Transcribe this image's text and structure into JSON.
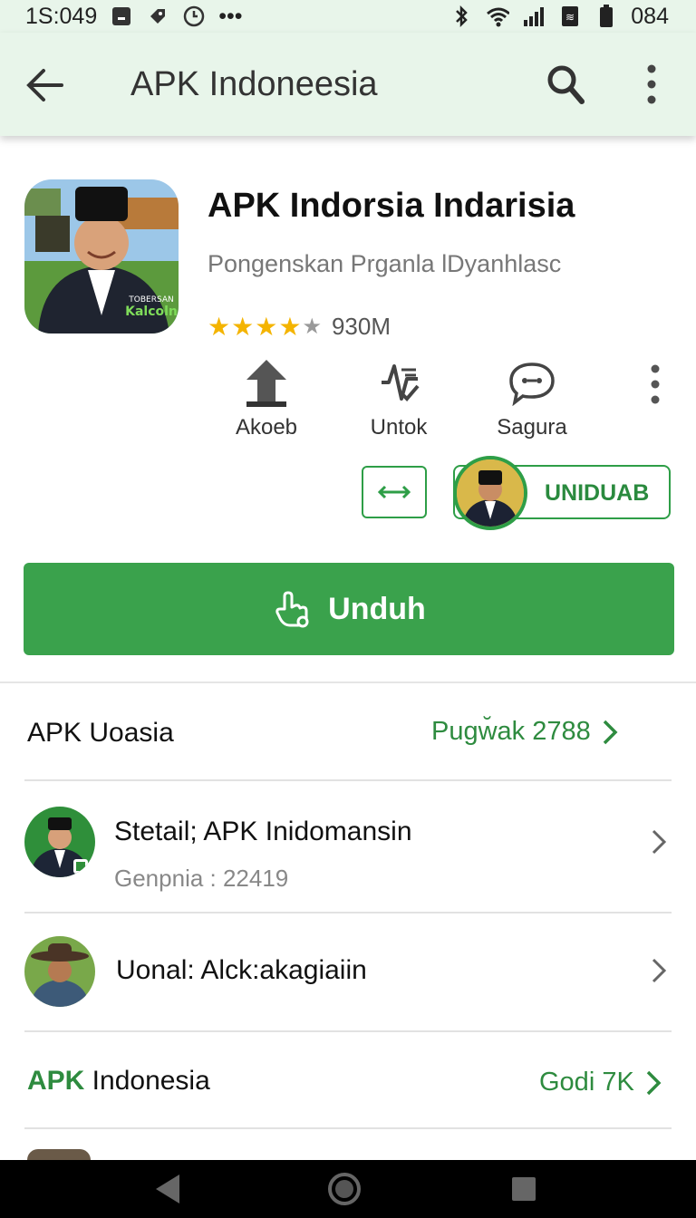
{
  "status_bar": {
    "time": "1S:049",
    "battery": "084"
  },
  "app_bar": {
    "title": "APK Indoneesia"
  },
  "app": {
    "name": "APK Indorsia Indarisia",
    "subtitle": "Pongenskan Prganla lDyanhlasc",
    "rating_stars": 4.5,
    "rating_count": "930M",
    "icon_badge_line1": "TOBERSAN",
    "icon_badge_line2": "Kalcoln"
  },
  "actions": [
    {
      "label": "Akoeb",
      "icon": "upload-arrow-icon"
    },
    {
      "label": "Untok",
      "icon": "activity-icon"
    },
    {
      "label": "Sagura",
      "icon": "chat-bubble-icon"
    }
  ],
  "secondary": {
    "unduab_label": "UNIDUAB"
  },
  "download": {
    "label": "Unduh"
  },
  "section1": {
    "title": "APK Uoasia",
    "link": "Pugw̆ak 2788"
  },
  "list": [
    {
      "title": "Stetail; APK Inidomansin",
      "sub": "Genpnia : 22419"
    },
    {
      "title": "Uonal: Alck:akagiaiin",
      "sub": ""
    }
  ],
  "section2": {
    "title_accent": "APK",
    "title_rest": " Indonesia",
    "link": "Godi 7K"
  },
  "colors": {
    "accent": "#3aa24c",
    "accent_dark": "#2e8b3f",
    "app_bar": "#e8f5ea"
  }
}
